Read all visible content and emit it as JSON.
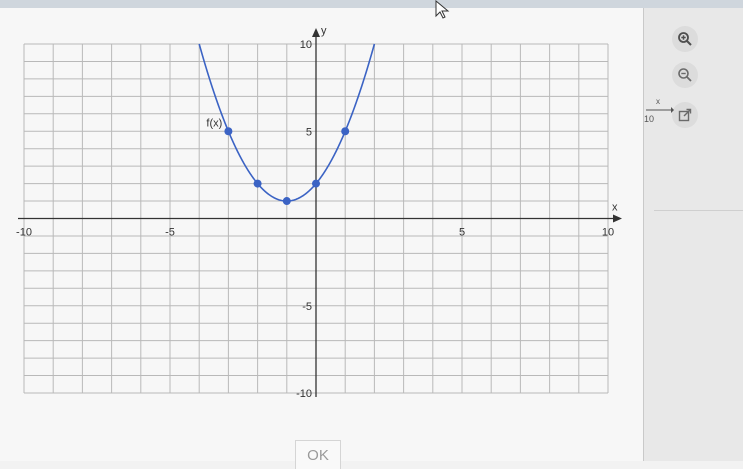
{
  "chart_data": {
    "type": "line",
    "xlim": [
      -10,
      10
    ],
    "ylim": [
      -10,
      10
    ],
    "xlabel": "x",
    "ylabel": "y",
    "grid": true,
    "x_tick_labels": [
      "-10",
      "-5",
      "5",
      "10"
    ],
    "y_tick_labels": [
      "10",
      "5",
      "-5",
      "-10"
    ],
    "series": [
      {
        "name": "f(x)",
        "function": "(x+1)^2+1",
        "domain": [
          -4,
          2
        ],
        "color": "#3b63c4",
        "points": [
          {
            "x": -3,
            "y": 5
          },
          {
            "x": -2,
            "y": 2
          },
          {
            "x": -1,
            "y": 1
          },
          {
            "x": 0,
            "y": 2
          },
          {
            "x": 1,
            "y": 5
          }
        ]
      }
    ]
  },
  "tools": {
    "zoom_in_icon": "zoom-in-icon",
    "zoom_out_icon": "zoom-out-icon",
    "popout_icon": "external-link-icon"
  },
  "side_axis": {
    "value": "10",
    "label": "x"
  },
  "dialog": {
    "ok_label": "OK"
  },
  "colors": {
    "curve": "#3b63c4",
    "grid": "#b9b9b9",
    "axis": "#333333"
  }
}
